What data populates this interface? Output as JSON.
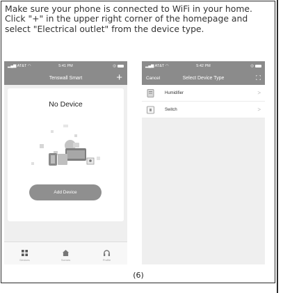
{
  "instructions": {
    "line1": "Make sure your phone is connected to WiFi in your home.",
    "line2": "Click \"+\" in the upper right corner of the homepage and",
    "line3": "select \"Electrical outlet\" from the device type."
  },
  "phone_left": {
    "status": {
      "carrier": "AT&T",
      "time": "5:41 PM"
    },
    "nav_title": "Tenswall Smart",
    "add_symbol": "+",
    "empty_title": "No Device",
    "add_button": "Add Device",
    "tabs": [
      {
        "label": "Devices"
      },
      {
        "label": "Scenes"
      },
      {
        "label": "Profile"
      }
    ]
  },
  "phone_right": {
    "status": {
      "carrier": "AT&T",
      "time": "5:42 PM"
    },
    "cancel": "Cancel",
    "nav_title": "Select Device Type",
    "devices": [
      {
        "label": "Humidifier",
        "chevron": ">"
      },
      {
        "label": "Switch",
        "chevron": ">"
      }
    ]
  },
  "page_number": "(6)"
}
